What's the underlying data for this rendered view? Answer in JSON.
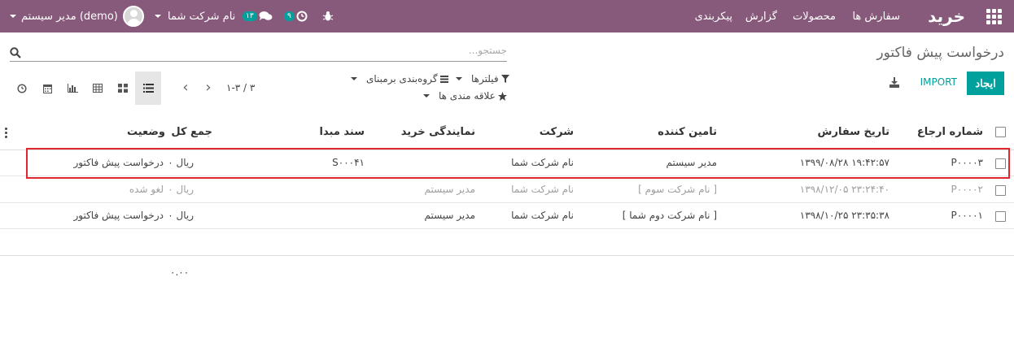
{
  "navbar": {
    "brand": "خرید",
    "menu": [
      "سفارش ها",
      "محصولات",
      "گزارش",
      "پیکربندی"
    ],
    "chat_count": "۱۳",
    "activity_count": "۹",
    "company": "نام شرکت شما",
    "user": "مدیر سیستم (demo)"
  },
  "control": {
    "title": "درخواست پیش فاکتور",
    "search_placeholder": "جستجو...",
    "create_label": "ایجاد",
    "import_label": "IMPORT",
    "filters_label": "فیلترها",
    "groupby_label": "گروه‌بندی برمبنای",
    "favorites_label": "علاقه مندی ها",
    "pager": "۱-۳ / ۳"
  },
  "table": {
    "headers": {
      "reference": "شماره ارجاع",
      "order_date": "تاریخ سفارش",
      "vendor": "تامین کننده",
      "company": "شرکت",
      "purchase_rep": "نمایندگی خرید",
      "source": "سند مبدا",
      "total": "جمع کل",
      "status": "وضعیت"
    },
    "rows": [
      {
        "reference": "P۰۰۰۰۳",
        "order_date": "۱۳۹۹/۰۸/۲۸ ۱۹:۴۲:۵۷",
        "vendor": "مدیر سیستم",
        "company": "نام شرکت شما",
        "purchase_rep": "",
        "source": "S۰۰۰۴۱",
        "total": "۰ ریال",
        "status": "درخواست پیش فاکتور"
      },
      {
        "reference": "P۰۰۰۰۲",
        "order_date": "۱۳۹۸/۱۲/۰۵ ۲۳:۲۴:۴۰",
        "vendor": "[ نام شرکت سوم ]",
        "company": "نام شرکت شما",
        "purchase_rep": "مدیر سیستم",
        "source": "",
        "total": "۰ ریال",
        "status": "لغو شده"
      },
      {
        "reference": "P۰۰۰۰۱",
        "order_date": "۱۳۹۸/۱۰/۲۵ ۲۳:۳۵:۳۸",
        "vendor": "[ نام شرکت دوم شما ]",
        "company": "نام شرکت شما",
        "purchase_rep": "مدیر سیستم",
        "source": "",
        "total": "۰ ریال",
        "status": "درخواست پیش فاکتور"
      }
    ],
    "footer_total": "۰.۰۰"
  },
  "colors": {
    "navbar": "#875a7b",
    "accent": "#00a09d",
    "highlight": "#e0262f"
  }
}
